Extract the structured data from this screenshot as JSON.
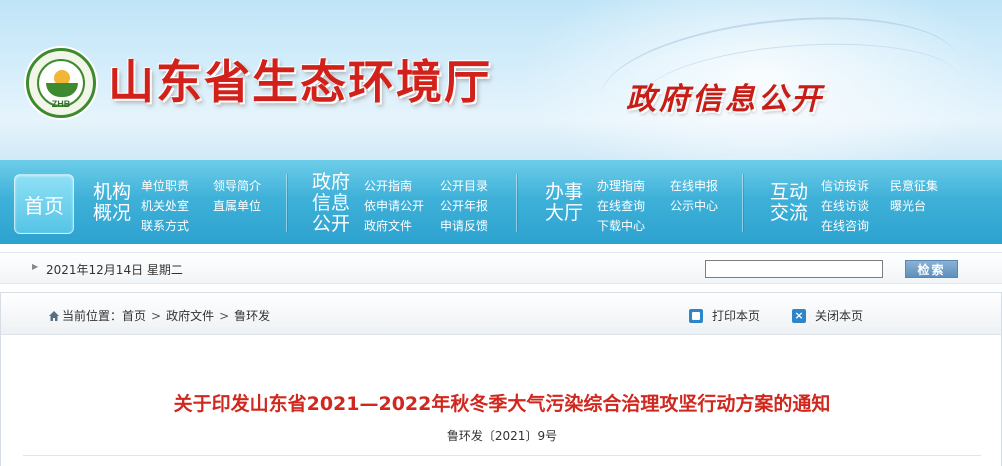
{
  "header": {
    "logo_text": "ZHB",
    "site_title": "山东省生态环境厅",
    "section_title": "政府信息公开"
  },
  "nav": {
    "home": "首页",
    "groups": [
      {
        "title": [
          "机构",
          "概况"
        ],
        "links": [
          "单位职责",
          "领导简介",
          "机关处室",
          "直属单位",
          "联系方式"
        ]
      },
      {
        "title": [
          "政府",
          "信息",
          "公开"
        ],
        "links": [
          "公开指南",
          "公开目录",
          "依申请公开",
          "公开年报",
          "政府文件",
          "申请反馈"
        ]
      },
      {
        "title": [
          "办事",
          "大厅"
        ],
        "links": [
          "办理指南",
          "在线申报",
          "在线查询",
          "公示中心",
          "下载中心"
        ]
      },
      {
        "title": [
          "互动",
          "交流"
        ],
        "links": [
          "信访投诉",
          "民意征集",
          "在线访谈",
          "曝光台",
          "在线咨询"
        ]
      }
    ]
  },
  "datebar": {
    "date": "2021年12月14日 星期二",
    "search_value": "",
    "search_button": "检索"
  },
  "breadcrumb": {
    "prefix": "当前位置：",
    "items": [
      "首页",
      "政府文件",
      "鲁环发"
    ]
  },
  "tools": {
    "print": "打印本页",
    "close": "关闭本页"
  },
  "document": {
    "title": "关于印发山东省2021—2022年秋冬季大气污染综合治理攻坚行动方案的通知",
    "number": "鲁环发〔2021〕9号"
  },
  "colors": {
    "title_red": "#d2211b",
    "nav_blue": "#3fb1d9",
    "doc_title_red": "#d0281e"
  }
}
